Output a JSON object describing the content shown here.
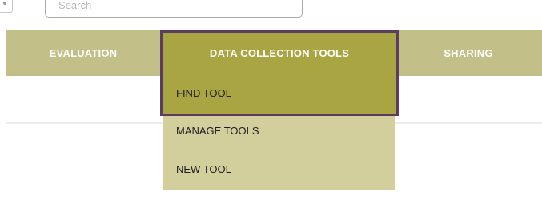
{
  "search": {
    "placeholder": "Search"
  },
  "nav": {
    "items": [
      {
        "label": "EVALUATION"
      },
      {
        "label": "DATA COLLECTION TOOLS"
      },
      {
        "label": "SHARING"
      }
    ],
    "active_index": 1
  },
  "dropdown": {
    "items": [
      {
        "label": "FIND TOOL"
      },
      {
        "label": "MANAGE TOOLS"
      },
      {
        "label": "NEW TOOL"
      }
    ],
    "highlighted_index": 0
  },
  "colors": {
    "nav_background": "#c2bf88",
    "nav_active_background": "#a9a542",
    "dropdown_background": "#d3cf9c",
    "highlight_border": "#5d3c61"
  }
}
